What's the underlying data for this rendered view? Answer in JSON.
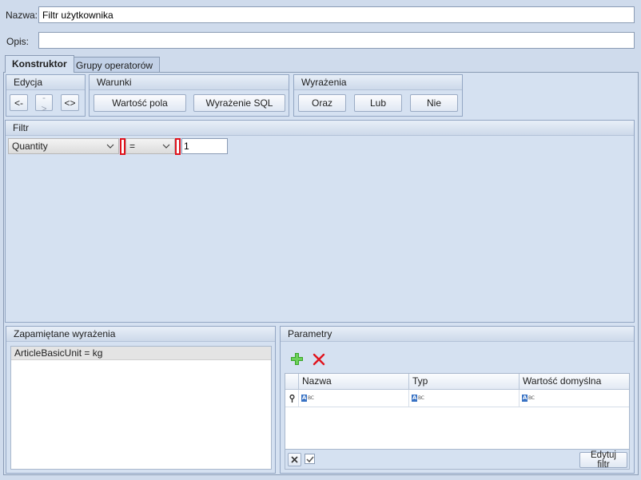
{
  "header": {
    "name_label": "Nazwa:",
    "name_value": "Filtr użytkownika",
    "desc_label": "Opis:",
    "desc_value": ""
  },
  "tabs": [
    {
      "label": "Konstruktor",
      "active": true
    },
    {
      "label": "Grupy operatorów",
      "active": false
    }
  ],
  "toolbar": {
    "edycja": {
      "title": "Edycja",
      "buttons": [
        "<-",
        "->",
        "<>"
      ]
    },
    "warunki": {
      "title": "Warunki",
      "buttons": [
        "Wartość pola",
        "Wyrażenie SQL"
      ]
    },
    "wyrazenia": {
      "title": "Wyrażenia",
      "buttons": [
        "Oraz",
        "Lub",
        "Nie"
      ]
    }
  },
  "filter": {
    "title": "Filtr",
    "field_value": "Quantity",
    "operator_value": "=",
    "value": "1"
  },
  "saved": {
    "title": "Zapamiętane wyrażenia",
    "items": [
      "ArticleBasicUnit = kg"
    ]
  },
  "params": {
    "title": "Parametry",
    "columns": [
      "Nazwa",
      "Typ",
      "Wartość domyślna"
    ],
    "edit_button": "Edytuj filtr"
  },
  "colors": {
    "background": "#cfdbec",
    "accent_red": "#e0141e",
    "add_green": "#3aa52a"
  }
}
